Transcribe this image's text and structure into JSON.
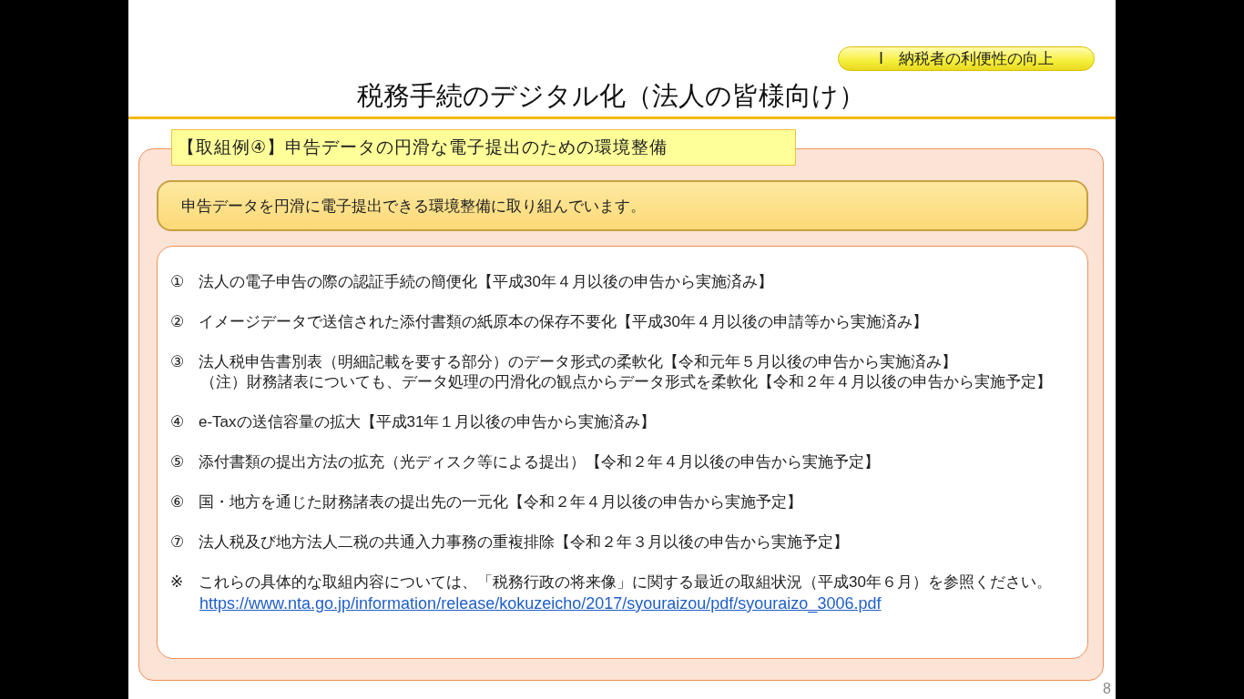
{
  "slide": {
    "section_badge": "Ⅰ　納税者の利便性の向上",
    "title": "税務手続のデジタル化（法人の皆様向け）",
    "example_tab": "【取組例④】申告データの円滑な電子提出のための環境整備",
    "summary": "申告データを円滑に電子提出できる環境整備に取り組んでいます。",
    "items": [
      {
        "number": "①",
        "text": "法人の電子申告の際の認証手続の簡便化【平成30年４月以後の申告から実施済み】"
      },
      {
        "number": "②",
        "text": "イメージデータで送信された添付書類の紙原本の保存不要化【平成30年４月以後の申請等から実施済み】"
      },
      {
        "number": "③",
        "text": "法人税申告書別表（明細記載を要する部分）のデータ形式の柔軟化【令和元年５月以後の申告から実施済み】",
        "note": "（注）財務諸表についても、データ処理の円滑化の観点からデータ形式を柔軟化【令和２年４月以後の申告から実施予定】"
      },
      {
        "number": "④",
        "text": "e-Taxの送信容量の拡大【平成31年１月以後の申告から実施済み】"
      },
      {
        "number": "⑤",
        "text": "添付書類の提出方法の拡充（光ディスク等による提出）【令和２年４月以後の申告から実施予定】"
      },
      {
        "number": "⑥",
        "text": "国・地方を通じた財務諸表の提出先の一元化【令和２年４月以後の申告から実施予定】"
      },
      {
        "number": "⑦",
        "text": "法人税及び地方法人二税の共通入力事務の重複排除【令和２年３月以後の申告から実施予定】"
      }
    ],
    "footnote": {
      "mark": "※",
      "text": "これらの具体的な取組内容については、「税務行政の将来像」に関する最近の取組状況（平成30年６月）を参照ください。",
      "link": "https://www.nta.go.jp/information/release/kokuzeicho/2017/syouraizou/pdf/syouraizo_3006.pdf"
    },
    "page_number": "8"
  }
}
